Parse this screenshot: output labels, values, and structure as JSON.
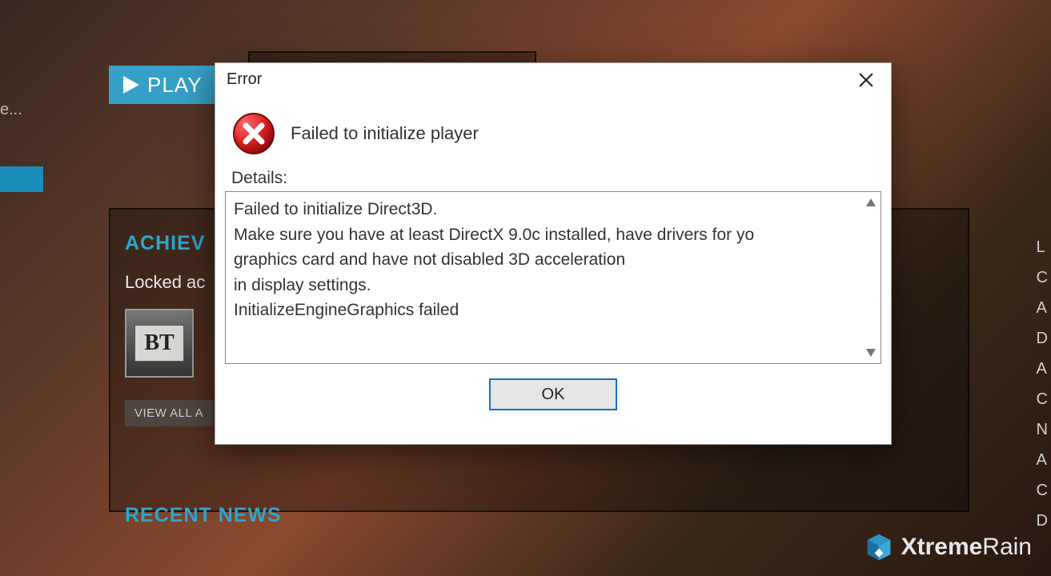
{
  "background": {
    "play_button_label": "PLAY",
    "truncated_left": "e...",
    "achievements_title": "ACHIEV",
    "locked_text": "Locked ac",
    "bt_tile_label": "BT",
    "view_all_label": "VIEW ALL A",
    "recent_news_title": "RECENT NEWS",
    "right_letters": [
      "L",
      "C",
      "A",
      "D",
      "A",
      "C",
      "N",
      "A",
      "C",
      "D"
    ]
  },
  "dialog": {
    "title": "Error",
    "heading": "Failed to initialize player",
    "details_label": "Details:",
    "details_text": "Failed to initialize Direct3D.\nMake sure you have at least DirectX 9.0c installed, have drivers for yo\ngraphics card and have not disabled 3D acceleration\nin display settings.\nInitializeEngineGraphics failed",
    "ok_label": "OK"
  },
  "logo": {
    "strong": "Xtreme",
    "light": "Rain"
  }
}
